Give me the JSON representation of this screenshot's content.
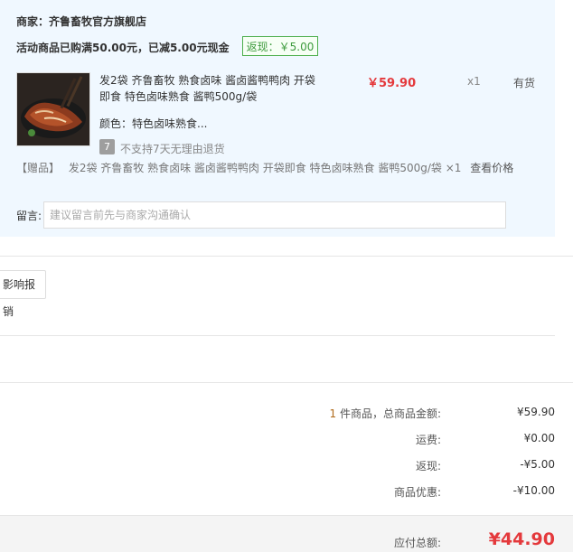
{
  "merchant": {
    "label": "商家：",
    "name": "齐鲁畜牧官方旗舰店"
  },
  "promotion": {
    "text": "活动商品已购满50.00元，已减5.00元现金",
    "rebate_badge": "返现：￥5.00"
  },
  "product": {
    "title": "发2袋 齐鲁畜牧 熟食卤味 酱卤酱鸭鸭肉 开袋即食 特色卤味熟食 酱鸭500g/袋",
    "price": "￥59.90",
    "quantity": "x1",
    "stock": "有货",
    "color_label": "颜色：",
    "color_value": "特色卤味熟食...",
    "return_policy": "不支持7天无理由退货",
    "return_icon_text": "7"
  },
  "gift": {
    "tag": "【赠品】",
    "text": "发2袋 齐鲁畜牧 熟食卤味 酱卤酱鸭鸭肉 开袋即食 特色卤味熟食 酱鸭500g/袋 ×1",
    "view_price": "查看价格"
  },
  "message": {
    "label": "留言:",
    "placeholder": "建议留言前先与商家沟通确认"
  },
  "report_button": "影响报销",
  "summary": {
    "count": "1",
    "count_suffix": " 件商品，总商品金额:",
    "total": "¥59.90",
    "shipping_label": "运费:",
    "shipping": "¥0.00",
    "rebate_label": "返现:",
    "rebate": "-¥5.00",
    "discount_label": "商品优惠:",
    "discount": "-¥10.00"
  },
  "payable": {
    "label": "应付总额:",
    "amount": "¥44.90"
  },
  "colors": {
    "accent_red": "#e4393c",
    "panel_bg": "#f0f8ff",
    "badge_green": "#4cae4c"
  }
}
